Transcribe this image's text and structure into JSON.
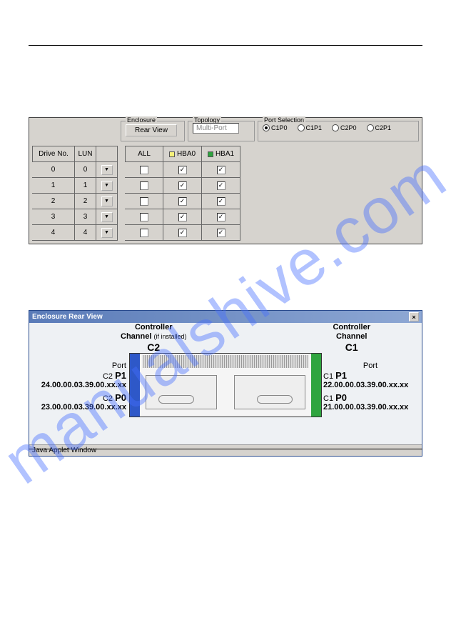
{
  "watermark": "manualshive.com",
  "applet1": {
    "enclosure": {
      "legend": "Enclosure",
      "button": "Rear View"
    },
    "topology": {
      "legend": "Topology",
      "select": "Multi-Port"
    },
    "portsel": {
      "legend": "Port Selection",
      "options": [
        "C1P0",
        "C1P1",
        "C2P0",
        "C2P1"
      ],
      "selected": 0
    },
    "cols_left": [
      "Drive No.",
      "LUN",
      ""
    ],
    "cols_right": [
      "ALL",
      "HBA0",
      "HBA1"
    ],
    "hba0_color": "#f7f17a",
    "hba1_color": "#2fa53f",
    "rows": [
      {
        "drive": "0",
        "lun": "0",
        "all": false,
        "hba0": true,
        "hba1": true
      },
      {
        "drive": "1",
        "lun": "1",
        "all": false,
        "hba0": true,
        "hba1": true
      },
      {
        "drive": "2",
        "lun": "2",
        "all": false,
        "hba0": true,
        "hba1": true
      },
      {
        "drive": "3",
        "lun": "3",
        "all": false,
        "hba0": true,
        "hba1": true
      },
      {
        "drive": "4",
        "lun": "4",
        "all": false,
        "hba0": true,
        "hba1": true
      }
    ]
  },
  "applet2": {
    "title": "Enclosure Rear View",
    "c2": {
      "head1": "Controller",
      "head2": "Channel",
      "note": "(if installed)",
      "name": "C2"
    },
    "c1": {
      "head1": "Controller",
      "head2": "Channel",
      "name": "C1"
    },
    "port_label": "Port",
    "left": {
      "p1": {
        "cp": "C2",
        "port": "P1",
        "wwn": "24.00.00.03.39.00.xx.xx"
      },
      "p0": {
        "cp": "C2",
        "port": "P0",
        "wwn": "23.00.00.03.39.00.xx.xx"
      }
    },
    "right": {
      "p1": {
        "cp": "C1",
        "port": "P1",
        "wwn": "22.00.00.03.39.00.xx.xx"
      },
      "p0": {
        "cp": "C1",
        "port": "P0",
        "wwn": "21.00.00.03.39.00.xx.xx"
      }
    },
    "status": "Java Applet Window"
  }
}
